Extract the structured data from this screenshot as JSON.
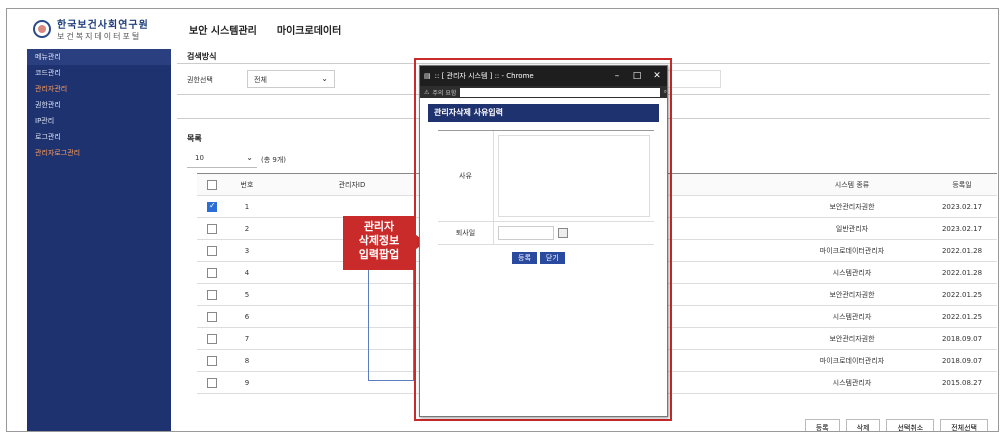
{
  "logo": {
    "line1": "한국보건사회연구원",
    "line2": "보건복지데이터포털"
  },
  "topnav": [
    "보안 시스템관리",
    "마이크로데이터"
  ],
  "sidebar": [
    {
      "label": "메뉴관리",
      "active": false
    },
    {
      "label": "코드관리",
      "active": false
    },
    {
      "label": "관리자관리",
      "active": true
    },
    {
      "label": "권한관리",
      "active": false
    },
    {
      "label": "IP관리",
      "active": false
    },
    {
      "label": "로그관리",
      "active": false
    },
    {
      "label": "관리자로그관리",
      "active": true
    }
  ],
  "search": {
    "section_title": "검색방식",
    "label": "권한선택",
    "value": "전체"
  },
  "list": {
    "section_title": "목록",
    "per_page": "10",
    "total": "(총 9개)"
  },
  "table": {
    "headers": [
      "번호",
      "관리자ID",
      "시스템 종류",
      "등록일"
    ],
    "rows": [
      {
        "checked": true,
        "no": "1",
        "system": "보안관리자권한",
        "date": "2023.02.17"
      },
      {
        "checked": false,
        "no": "2",
        "system": "일반관리자",
        "date": "2023.02.17"
      },
      {
        "checked": false,
        "no": "3",
        "system": "마이크로데이터관리자",
        "date": "2022.01.28"
      },
      {
        "checked": false,
        "no": "4",
        "system": "시스템관리자",
        "date": "2022.01.28"
      },
      {
        "checked": false,
        "no": "5",
        "system": "보안관리자권한",
        "date": "2022.01.25"
      },
      {
        "checked": false,
        "no": "6",
        "system": "시스템관리자",
        "date": "2022.01.25"
      },
      {
        "checked": false,
        "no": "7",
        "system": "보안관리자권한",
        "date": "2018.09.07"
      },
      {
        "checked": false,
        "no": "8",
        "system": "마이크로데이터관리자",
        "date": "2018.09.07"
      },
      {
        "checked": false,
        "no": "9",
        "system": "시스템관리자",
        "date": "2015.08.27"
      }
    ]
  },
  "buttons": {
    "register": "등록",
    "delete": "삭제",
    "deselect": "선택취소",
    "select_all": "전체선택"
  },
  "callout": {
    "line1": "관리자",
    "line2": "삭제정보",
    "line3": "입력팝업"
  },
  "popup": {
    "window_title": ":: [ 관리자 시스템 ] :: - Chrome",
    "address_warning": "주의 요함",
    "heading": "관리자삭제 사유입력",
    "reason_label": "사유",
    "retire_label": "퇴사일",
    "register_button": "등록",
    "close_button": "닫기"
  },
  "colors": {
    "sidebar": "#1f3270",
    "accent_red": "#c92a2a",
    "button_blue": "#2a4aa0"
  }
}
